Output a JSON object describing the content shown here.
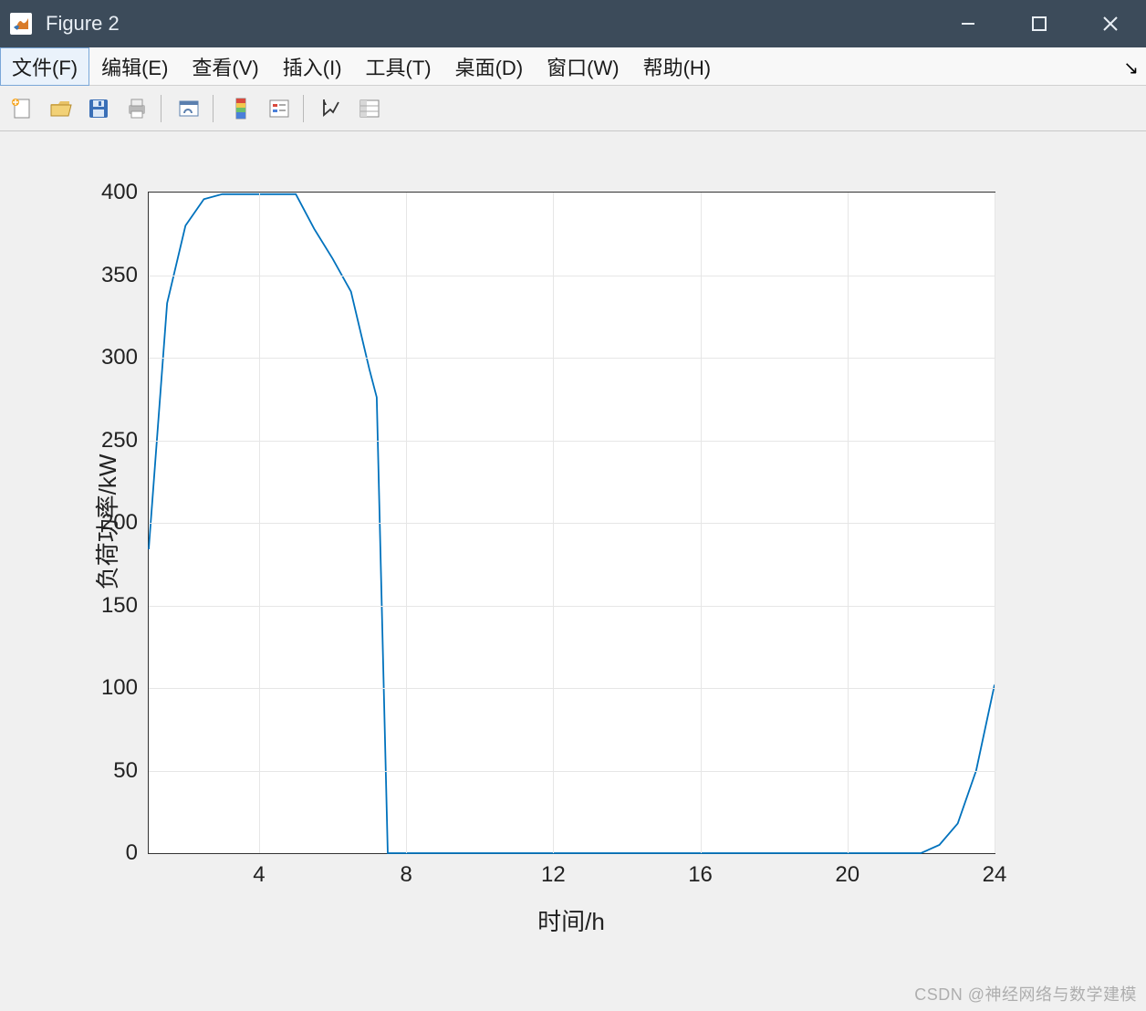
{
  "window": {
    "title": "Figure 2"
  },
  "menu": {
    "file": "文件(F)",
    "edit": "编辑(E)",
    "view": "查看(V)",
    "insert": "插入(I)",
    "tools": "工具(T)",
    "desktop": "桌面(D)",
    "window": "窗口(W)",
    "help": "帮助(H)"
  },
  "chart_data": {
    "type": "line",
    "x": [
      1,
      1.5,
      2,
      2.5,
      3,
      4,
      5,
      5.5,
      6,
      6.5,
      7,
      7.2,
      7.5,
      8,
      9,
      10,
      11,
      12,
      13,
      14,
      15,
      16,
      17,
      18,
      19,
      20,
      21,
      22,
      22.5,
      23,
      23.5,
      24
    ],
    "y": [
      184,
      333,
      380,
      396,
      399,
      399,
      399,
      378,
      360,
      340,
      293,
      276,
      0,
      0,
      0,
      0,
      0,
      0,
      0,
      0,
      0,
      0,
      0,
      0,
      0,
      0,
      0,
      0,
      5,
      18,
      50,
      102
    ],
    "xlabel": "时间/h",
    "ylabel": "负荷功率/kW",
    "xlim": [
      1,
      24
    ],
    "ylim": [
      0,
      400
    ],
    "xticks": [
      4,
      8,
      12,
      16,
      20,
      24
    ],
    "yticks": [
      0,
      50,
      100,
      150,
      200,
      250,
      300,
      350,
      400
    ],
    "line_color": "#0072bd"
  },
  "watermark": "CSDN @神经网络与数学建模"
}
